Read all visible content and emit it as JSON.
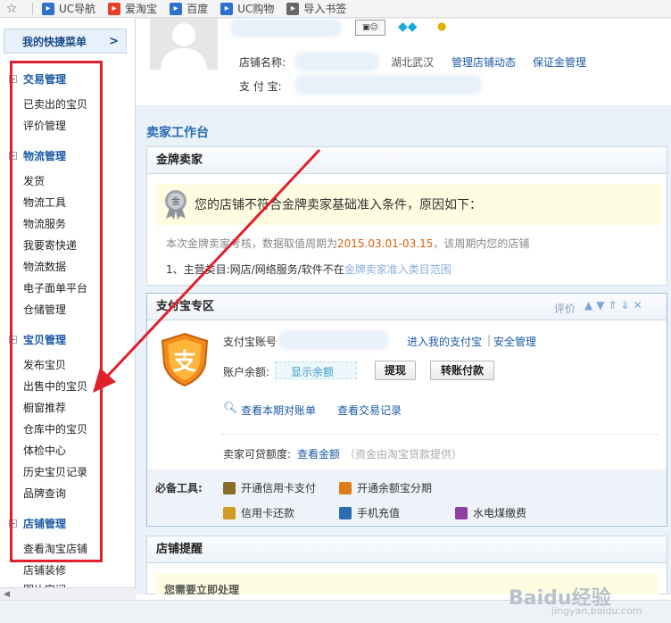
{
  "bookmarks": [
    {
      "icon": "uc-nav-icon",
      "label": "UC导航",
      "color": "#2f6fd0"
    },
    {
      "icon": "taobao-icon",
      "label": "爱淘宝",
      "color": "#e8402a"
    },
    {
      "icon": "baidu-icon",
      "label": "百度",
      "color": "#2f6fd0"
    },
    {
      "icon": "uc-shop-icon",
      "label": "UC购物",
      "color": "#2f6fd0"
    },
    {
      "icon": "import-icon",
      "label": "导入书签",
      "color": "#666666"
    }
  ],
  "sidebar": {
    "header": "我的快捷菜单",
    "header_arrow": ">",
    "groups": [
      {
        "title": "交易管理",
        "items": [
          "已卖出的宝贝",
          "评价管理"
        ]
      },
      {
        "title": "物流管理",
        "items": [
          "发货",
          "物流工具",
          "物流服务",
          "我要寄快递",
          "物流数据",
          "电子面单平台",
          "仓储管理"
        ]
      },
      {
        "title": "宝贝管理",
        "items": [
          "发布宝贝",
          "出售中的宝贝",
          "橱窗推荐",
          "仓库中的宝贝",
          "体检中心",
          "历史宝贝记录",
          "品牌查询"
        ]
      },
      {
        "title": "店铺管理",
        "items": [
          "查看淘宝店铺",
          "店铺装修",
          "图片空间"
        ]
      }
    ]
  },
  "shop": {
    "name_label": "店铺名称:",
    "location": "湖北武汉",
    "manage_link": "管理店铺动态",
    "deposit_link": "保证金管理",
    "alipay_label": "支 付 宝:"
  },
  "workbench_title": "卖家工作台",
  "gold": {
    "title": "金牌卖家",
    "notice": "您的店铺不符合金牌卖家基础准入条件，原因如下：",
    "period_prefix": "本次金牌卖家考核，数据取值周期为",
    "period": "2015.03.01-03.15",
    "period_suffix": "，该周期内您的店铺",
    "reason_prefix": "1、主营类目:网店/网络服务/软件不在",
    "reason_link": "金牌卖家准入类目范围",
    "medal_text": "金"
  },
  "alipay": {
    "title": "支付宝专区",
    "tools_label": "评价",
    "account_label": "支付宝账号",
    "enter_link": "进入我的支付宝",
    "divider": "|",
    "security_link": "安全管理",
    "balance_label": "账户余额:",
    "show_balance": "显示余额",
    "withdraw": "提现",
    "transfer": "转账付款",
    "bill_link": "查看本期对账单",
    "trade_link": "查看交易记录",
    "loan_label": "卖家可贷额度:",
    "loan_link": "查看金额",
    "loan_note": "（资金由淘宝贷款提供）",
    "badge_text": "支",
    "tools_title": "必备工具:",
    "tools": [
      {
        "icon": "credit-card-pay-icon",
        "label": "开通信用卡支付",
        "color": "#8a6d2a"
      },
      {
        "icon": "yuebao-icon",
        "label": "开通余额宝分期",
        "color": "#e07b1a"
      },
      {
        "icon": "credit-repay-icon",
        "label": "信用卡还款",
        "color": "#d19a25"
      },
      {
        "icon": "phone-recharge-icon",
        "label": "手机充值",
        "color": "#2b6cb5"
      },
      {
        "icon": "utility-pay-icon",
        "label": "水电煤缴费",
        "color": "#8e3fa0"
      }
    ]
  },
  "reminder": {
    "title": "店铺提醒",
    "sub": "您需要立即处理"
  },
  "watermark": "Baidu经验",
  "watermark_url": "jingyan.baidu.com"
}
